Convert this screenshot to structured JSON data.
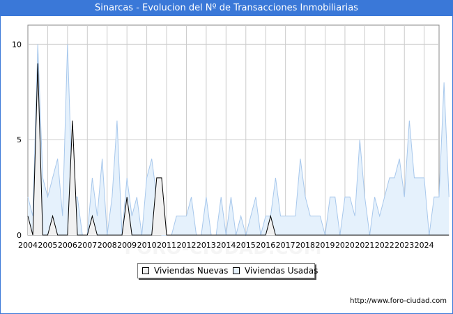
{
  "title": "Sinarcas - Evolucion del Nº de Transacciones Inmobiliarias",
  "footer_url": "http://www.foro-ciudad.com",
  "watermark": "FORO-CIUDAD.COM",
  "colors": {
    "header_bg": "#3a78d8",
    "nuevas_fill": "#f1f1f1",
    "nuevas_line": "#000000",
    "usadas_fill": "#e5f1fc",
    "usadas_line": "#a8c8ec",
    "grid": "#cccccc"
  },
  "chart_data": {
    "type": "area",
    "title": "Sinarcas - Evolucion del Nº de Transacciones Inmobiliarias",
    "xlabel": "",
    "ylabel": "",
    "x_ticks": [
      "2004",
      "2005",
      "2006",
      "2007",
      "2008",
      "2009",
      "2010",
      "2011",
      "2012",
      "2013",
      "2014",
      "2015",
      "2016",
      "2017",
      "2018",
      "2019",
      "2020",
      "2021",
      "2022",
      "2023",
      "2024"
    ],
    "y_ticks": [
      0,
      5,
      10
    ],
    "xlim": [
      2004,
      2024.75
    ],
    "ylim": [
      0,
      11
    ],
    "grid": true,
    "legend_position": "bottom",
    "granularity": "quarterly (4 points per year, starting 2004 Q1)",
    "series": [
      {
        "name": "Viviendas Nuevas",
        "values": [
          1,
          0,
          9,
          0,
          0,
          1,
          0,
          0,
          0,
          6,
          0,
          0,
          0,
          1,
          0,
          0,
          0,
          0,
          0,
          0,
          2,
          0,
          0,
          0,
          0,
          0,
          3,
          3,
          0,
          0,
          0,
          0,
          0,
          0,
          0,
          0,
          0,
          0,
          0,
          0,
          0,
          0,
          0,
          0,
          0,
          0,
          0,
          0,
          0,
          1,
          0,
          0,
          0,
          0,
          0,
          0,
          0,
          0,
          0,
          0,
          0,
          0,
          0,
          0,
          0,
          0,
          0,
          0,
          0,
          0,
          0,
          0,
          0,
          0,
          0,
          0,
          0,
          0,
          0,
          0,
          0,
          0,
          0,
          0,
          0,
          0
        ]
      },
      {
        "name": "Viviendas Usadas",
        "values": [
          2,
          1,
          10,
          3,
          2,
          3,
          4,
          1,
          10,
          2,
          2,
          0,
          0,
          3,
          1,
          4,
          0,
          2,
          6,
          0,
          3,
          1,
          2,
          0,
          3,
          4,
          2,
          0,
          0,
          0,
          1,
          1,
          1,
          2,
          0,
          0,
          2,
          0,
          0,
          2,
          0,
          2,
          0,
          1,
          0,
          1,
          2,
          0,
          1,
          1,
          3,
          1,
          1,
          1,
          1,
          4,
          2,
          1,
          1,
          1,
          0,
          2,
          2,
          0,
          2,
          2,
          1,
          5,
          2,
          0,
          2,
          1,
          2,
          3,
          3,
          4,
          2,
          6,
          3,
          3,
          3,
          0,
          2,
          2,
          8,
          2
        ]
      }
    ]
  }
}
